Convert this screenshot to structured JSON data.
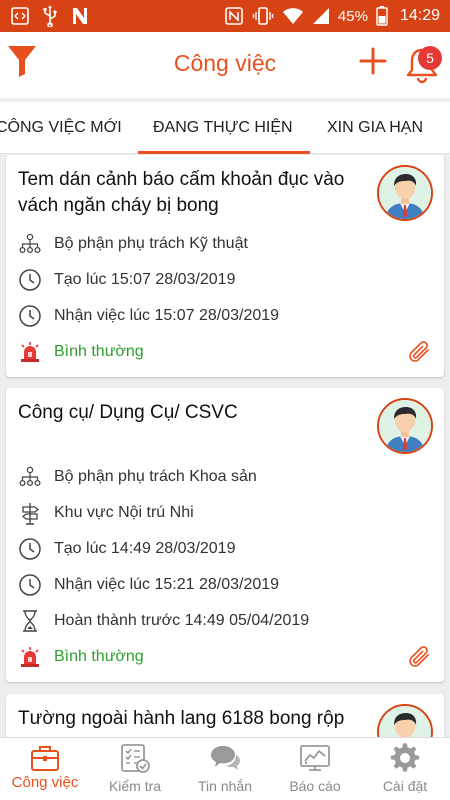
{
  "status_bar": {
    "battery": "45%",
    "time": "14:29"
  },
  "app_bar": {
    "title": "Công việc",
    "notification_count": "5"
  },
  "tabs": [
    {
      "label": "CÔNG VIỆC MỚI",
      "active": false
    },
    {
      "label": "ĐANG THỰC HIỆN",
      "active": true
    },
    {
      "label": "XIN GIA HẠN",
      "active": false
    }
  ],
  "tasks": [
    {
      "title": "Tem dán cảnh báo cấm khoản đục vào vách ngăn cháy bị bong",
      "department": "Bộ phận phụ trách Kỹ thuật",
      "created": "Tạo lúc 15:07 28/03/2019",
      "received": "Nhận việc lúc 15:07 28/03/2019",
      "priority": "Bình thường"
    },
    {
      "title": "Công cụ/ Dụng Cụ/ CSVC",
      "department": "Bộ phận phụ trách Khoa sản",
      "area": "Khu vực Nội trú Nhi",
      "created": "Tạo lúc 14:49 28/03/2019",
      "received": "Nhận việc lúc 15:21 28/03/2019",
      "deadline": "Hoàn thành trước 14:49 05/04/2019",
      "priority": "Bình thường"
    },
    {
      "title": "Tường ngoài hành lang 6188 bong rộp"
    }
  ],
  "bottom_nav": [
    {
      "label": "Công việc",
      "icon": "briefcase-icon",
      "active": true
    },
    {
      "label": "Kiểm tra",
      "icon": "checklist-icon",
      "active": false
    },
    {
      "label": "Tin nhắn",
      "icon": "chat-icon",
      "active": false
    },
    {
      "label": "Báo cáo",
      "icon": "report-icon",
      "active": false
    },
    {
      "label": "Cài đặt",
      "icon": "gear-icon",
      "active": false
    }
  ],
  "colors": {
    "accent": "#e8501d",
    "status_bar": "#d84315",
    "priority_normal": "#2e9f2e",
    "badge": "#e53935"
  }
}
